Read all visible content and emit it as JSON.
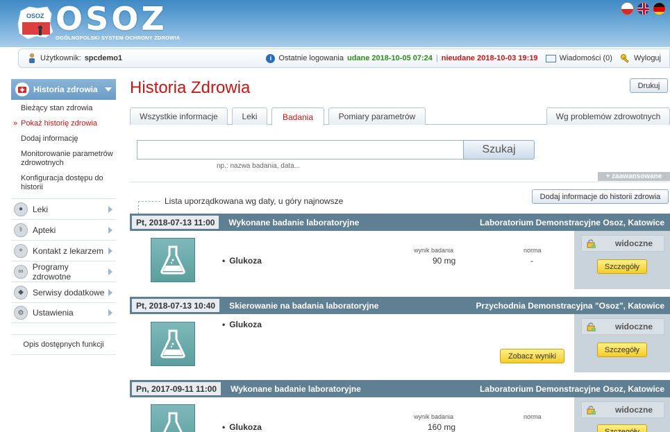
{
  "app": {
    "logo_text": "OSOZ",
    "logo_subtitle": "OGÓLNOPOLSKI SYSTEM OCHRONY ZDROWIA",
    "logo_map_text": "OSOZ"
  },
  "languages": [
    "pl",
    "en",
    "de"
  ],
  "userbar": {
    "user_label": "Użytkownik:",
    "user_name": "spcdemo1",
    "last_logins_label": "Ostatnie logowania",
    "ok_text": "udane 2018-10-05 07:24",
    "separator": "|",
    "bad_text": "nieudane 2018-10-03 19:19",
    "messages": "Wiadomości (0)",
    "logout": "Wyloguj"
  },
  "sidebar": {
    "active": "Historia zdrowia",
    "sub_items": [
      "Bieżący stan zdrowia",
      "Pokaż historię zdrowia",
      "Dodaj informację",
      "Monitorowanie parametrów zdrowotnych",
      "Konfiguracja dostępu do historii"
    ],
    "items": [
      "Leki",
      "Apteki",
      "Kontakt z lekarzem",
      "Programy zdrowotne",
      "Serwisy dodatkowe",
      "Ustawienia"
    ],
    "bottom": "Opis dostępnych funkcji"
  },
  "main": {
    "title": "Historia Zdrowia",
    "print_button": "Drukuj",
    "tabs": [
      "Wszystkie informacje",
      "Leki",
      "Badania",
      "Pomiary parametrów",
      "Wg problemów zdrowotnych"
    ],
    "active_tab": "Badania",
    "search_button": "Szukaj",
    "search_value": "",
    "search_hint": "np.: nazwa badania, data...",
    "advanced": "+ zaawansowane",
    "sort_note": "Lista uporządkowana wg daty, u góry najnowsze",
    "add_button": "Dodaj informacje do historii zdrowia"
  },
  "records": [
    {
      "date": "Pt, 2018-07-13 11:00",
      "type": "Wykonane badanie laboratoryjne",
      "place": "Laboratorium Demonstracyjne Osoz, Katowice",
      "item": "Glukoza",
      "result_label": "wynik badania",
      "result": "90  mg",
      "norm_label": "norma",
      "norm": "-",
      "visibility": "widoczne",
      "details": "Szczegóły"
    },
    {
      "date": "Pt, 2018-07-13 10:40",
      "type": "Skierowanie na badania laboratoryjne",
      "place": "Przychodnia Demonstracyjna \"Osoz\", Katowice",
      "item": "Glukoza",
      "see_results": "Zobacz wyniki",
      "visibility": "widoczne",
      "details": "Szczegóły"
    },
    {
      "date": "Pn, 2017-09-11 11:00",
      "type": "Wykonane badanie laboratoryjne",
      "place": "Laboratorium Demonstracyjne Osoz, Katowice",
      "item": "Glukoza",
      "result_label": "wynik badania",
      "result": "160  mg",
      "norm_label": "norma",
      "norm": "-",
      "visibility": "widoczne",
      "details": "Szczegóły"
    }
  ]
}
